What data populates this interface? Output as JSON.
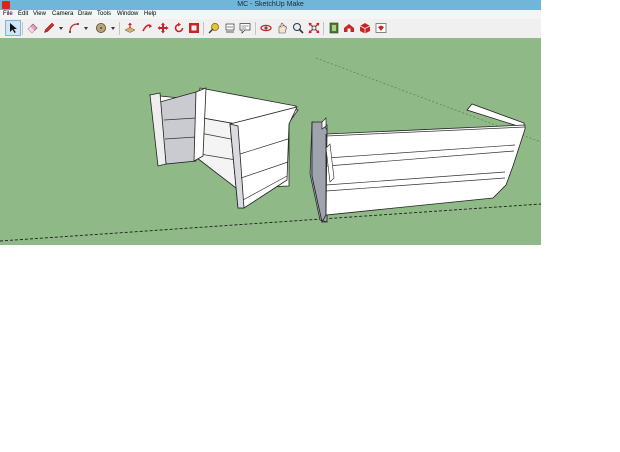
{
  "window": {
    "title": "MC - SketchUp Make"
  },
  "menu": {
    "items": [
      "File",
      "Edit",
      "View",
      "Camera",
      "Draw",
      "Tools",
      "Window",
      "Help"
    ]
  },
  "toolbar": {
    "tools": [
      {
        "icon": "select-arrow-icon",
        "active": true
      },
      {
        "icon": "eraser-icon"
      },
      {
        "icon": "pencil-icon",
        "dropdown": true
      },
      {
        "icon": "arc-icon",
        "dropdown": true
      },
      {
        "icon": "circle-icon",
        "dropdown": true
      },
      {
        "icon": "push-pull-icon"
      },
      {
        "icon": "follow-me-icon"
      },
      {
        "icon": "move-icon"
      },
      {
        "icon": "rotate-icon"
      },
      {
        "icon": "offset-icon"
      },
      {
        "icon": "tape-measure-icon"
      },
      {
        "icon": "dimension-icon"
      },
      {
        "icon": "text-icon"
      },
      {
        "icon": "orbit-icon"
      },
      {
        "icon": "pan-icon"
      },
      {
        "icon": "zoom-icon"
      },
      {
        "icon": "zoom-extents-icon"
      },
      {
        "icon": "components-icon"
      },
      {
        "icon": "warehouse-icon"
      },
      {
        "icon": "extension-icon"
      },
      {
        "icon": "ruby-console-icon"
      }
    ]
  },
  "colors": {
    "ground": "#8fb986",
    "titlebar": "#6fb6d8",
    "face": "#ffffff",
    "shaded_face": "#b9bcc4"
  }
}
